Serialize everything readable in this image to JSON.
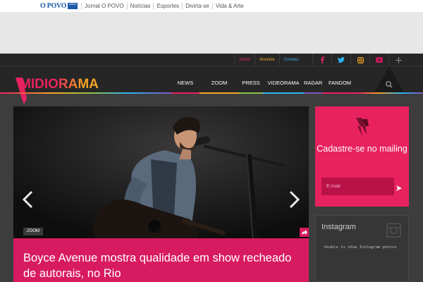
{
  "portal": {
    "logo_text": "O POVO",
    "badge_text": "online",
    "links": [
      "Jornal O POVO",
      "Notícias",
      "Esportes",
      "Divirta-se",
      "Vida & Arte"
    ]
  },
  "header": {
    "util_links": {
      "sobre": "Sobre",
      "anuncie": "Anuncie",
      "contato": "Contato"
    },
    "social_icons": [
      "facebook-icon",
      "twitter-icon",
      "instagram-icon",
      "youtube-icon",
      "plus-icon"
    ],
    "logo": "MIDIORAMA",
    "nav": [
      "NEWS",
      "ZOOM",
      "PRESS",
      "VIDEORAMA",
      "RADAR",
      "FANDOM"
    ],
    "nav_colors": [
      "#e8215f",
      "#f5a623",
      "#8bc34a",
      "#29b6f6",
      "#7e57c2",
      "#e8215f"
    ]
  },
  "hero": {
    "tag": "ZOOM",
    "title": "Boyce Avenue mostra qualidade em show recheado de autorais, no Rio"
  },
  "mailing": {
    "title": "Cadastre-se no mailing",
    "placeholder": "E-mail"
  },
  "instagram": {
    "title": "Instagram",
    "message": "Unable to show Instagram photos"
  },
  "colors": {
    "accent": "#e8215f",
    "header_bg": "#262626",
    "page_bg": "#3d3d3d"
  }
}
